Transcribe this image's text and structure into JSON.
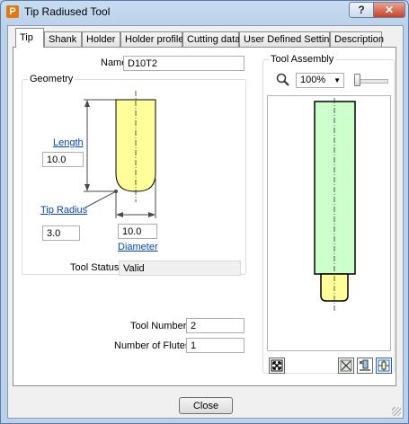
{
  "window": {
    "title": "Tip Radiused Tool",
    "app_icon_letter": "P",
    "help_label": "?",
    "close_label": "✕"
  },
  "tabs": [
    {
      "label": "Tip",
      "active": true
    },
    {
      "label": "Shank"
    },
    {
      "label": "Holder"
    },
    {
      "label": "Holder profile"
    },
    {
      "label": "Cutting data"
    },
    {
      "label": "User Defined Settings"
    },
    {
      "label": "Description"
    }
  ],
  "name": {
    "label": "Name",
    "value": "D10T2"
  },
  "geometry": {
    "title": "Geometry",
    "length_label": "Length",
    "length_value": "10.0",
    "tip_radius_label": "Tip Radius",
    "tip_radius_value": "3.0",
    "diameter_value": "10.0",
    "diameter_label": "Diameter",
    "tool_status_label": "Tool Status",
    "tool_status_value": "Valid",
    "colors": {
      "tool_fill": "#ffff99",
      "dim_line": "#4a4a4a"
    }
  },
  "tool_number": {
    "label": "Tool Number",
    "value": "2"
  },
  "flutes": {
    "label": "Number of Flutes",
    "value": "1"
  },
  "assembly": {
    "title": "Tool Assembly",
    "zoom_icon": "magnifier-icon",
    "zoom_value": "100%",
    "colors": {
      "holder_fill": "#ccffcc",
      "tip_fill": "#ffff99"
    }
  },
  "buttons": {
    "close_label": "Close"
  }
}
